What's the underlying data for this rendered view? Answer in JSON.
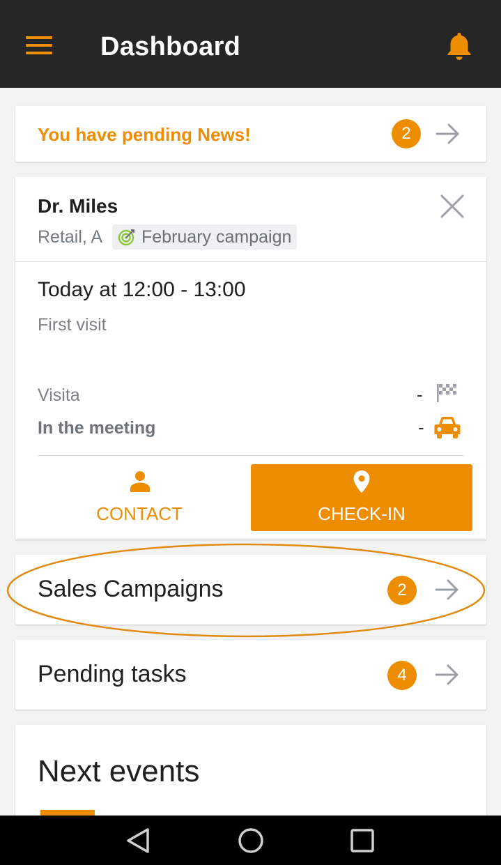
{
  "app": {
    "title": "Dashboard",
    "accent_color": "#ee8d00",
    "toolbar_color": "#262626",
    "menu_icon": "hamburger-menu-icon",
    "notification_icon": "bell-icon"
  },
  "news": {
    "text": "You have pending News!",
    "count": "2"
  },
  "visit": {
    "name": "Dr. Miles",
    "subtitle": "Retail, A",
    "campaign": "February campaign",
    "time": "Today at 12:00 - 13:00",
    "type": "First visit",
    "statuses": [
      {
        "label": "Visita",
        "value": "-",
        "icon": "checkered-flag-icon"
      },
      {
        "label": "In the meeting",
        "value": "-",
        "icon": "car-icon"
      }
    ],
    "contact_label": "CONTACT",
    "checkin_label": "CHECK-IN"
  },
  "sales_campaigns": {
    "label": "Sales Campaigns",
    "count": "2"
  },
  "pending_tasks": {
    "label": "Pending tasks",
    "count": "4"
  },
  "next_events": {
    "title": "Next events"
  },
  "system_nav": [
    "back-icon",
    "home-icon",
    "recents-icon"
  ]
}
